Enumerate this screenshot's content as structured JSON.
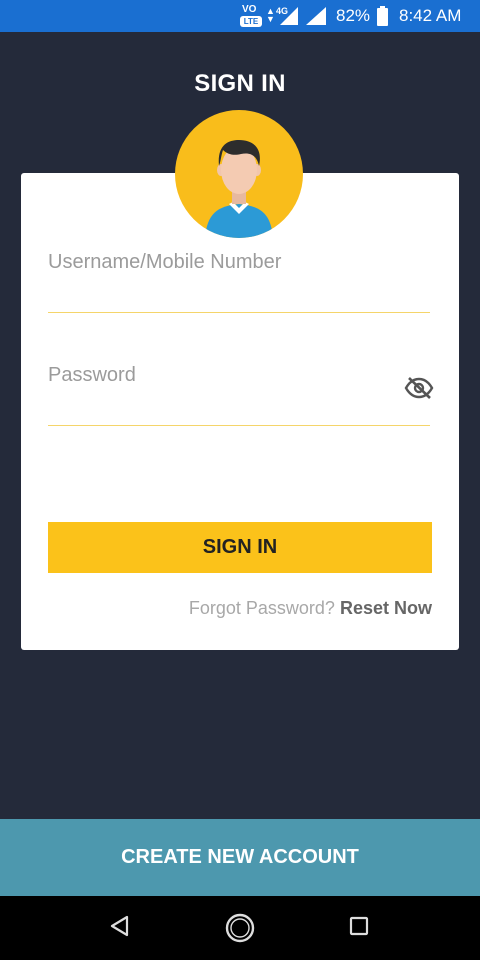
{
  "status_bar": {
    "volte_top": "VO",
    "volte_bottom": "LTE",
    "network_type": "4G",
    "battery_percent": "82%",
    "time": "8:42 AM"
  },
  "header": {
    "title": "SIGN IN"
  },
  "form": {
    "username_label": "Username/Mobile Number",
    "username_value": "",
    "password_label": "Password",
    "password_value": "",
    "signin_label": "SIGN IN",
    "forgot_text": "Forgot Password?",
    "reset_label": "Reset Now"
  },
  "footer": {
    "create_account_label": "CREATE NEW ACCOUNT"
  },
  "icons": {
    "avatar": "user-avatar-icon",
    "eye": "eye-off-icon",
    "back": "back-triangle-icon",
    "home": "home-circle-icon",
    "recents": "recents-square-icon"
  },
  "colors": {
    "background": "#242a3a",
    "status_bar": "#1a6fd1",
    "accent_yellow": "#fbc21a",
    "create_account_bg": "#4d98ae"
  }
}
